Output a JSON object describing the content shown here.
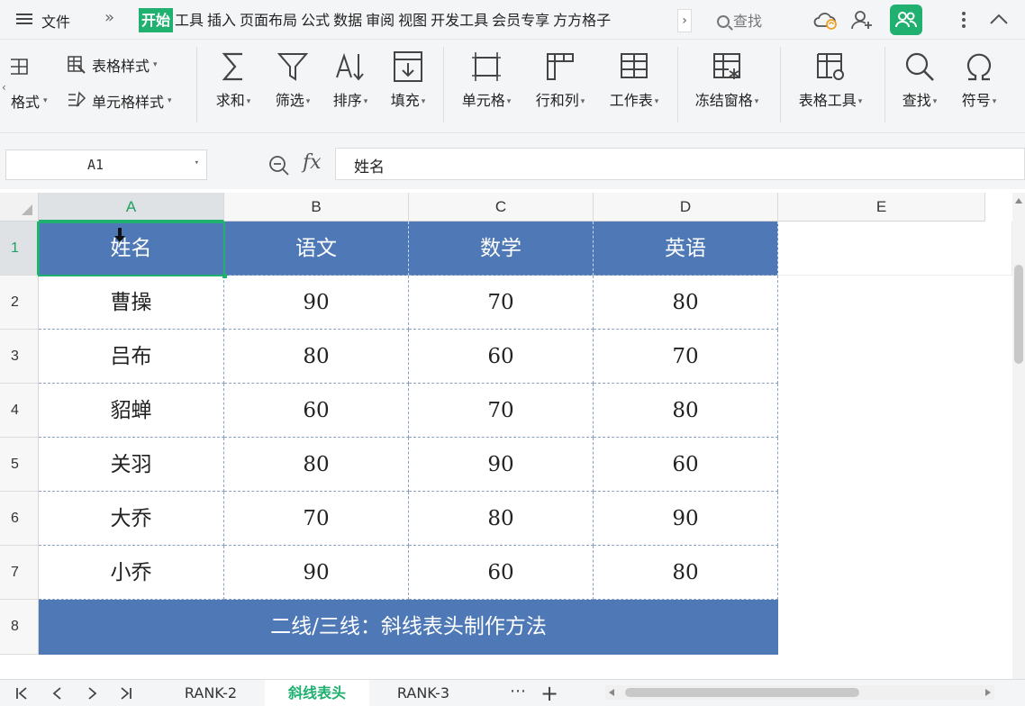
{
  "menu": {
    "file": "文件",
    "more": "»",
    "tabs": [
      "开始",
      "工具",
      "插入",
      "页面布局",
      "公式",
      "数据",
      "审阅",
      "视图",
      "开发工具",
      "会员专享",
      "方方格子"
    ],
    "tab_scroll": "›",
    "search": "查找"
  },
  "ribbon": {
    "format_partial": "格式",
    "table_style": "表格样式",
    "cell_style": "单元格样式",
    "sum": "求和",
    "filter": "筛选",
    "sort": "排序",
    "fill": "填充",
    "cell": "单元格",
    "row_col": "行和列",
    "worksheet": "工作表",
    "freeze": "冻结窗格",
    "table_tools": "表格工具",
    "find": "查找",
    "symbol": "符号"
  },
  "formula_bar": {
    "name_box": "A1",
    "fx": "fx",
    "value": "姓名"
  },
  "sheet": {
    "columns": [
      "A",
      "B",
      "C",
      "D",
      "E"
    ],
    "row_numbers": [
      "1",
      "2",
      "3",
      "4",
      "5",
      "6",
      "7",
      "8"
    ],
    "header": [
      "姓名",
      "语文",
      "数学",
      "英语"
    ],
    "rows": [
      [
        "曹操",
        "90",
        "70",
        "80"
      ],
      [
        "吕布",
        "80",
        "60",
        "70"
      ],
      [
        "貂蝉",
        "60",
        "70",
        "80"
      ],
      [
        "关羽",
        "80",
        "90",
        "60"
      ],
      [
        "大乔",
        "70",
        "80",
        "90"
      ],
      [
        "小乔",
        "90",
        "60",
        "80"
      ]
    ],
    "footer": "二线/三线：斜线表头制作方法",
    "accent_color": "#4e79b6",
    "selection_color": "#20b070"
  },
  "sheet_tabs": {
    "tabs": [
      "RANK-2",
      "斜线表头",
      "RANK-3"
    ],
    "active": "斜线表头",
    "more": "⋯",
    "add": "+"
  }
}
